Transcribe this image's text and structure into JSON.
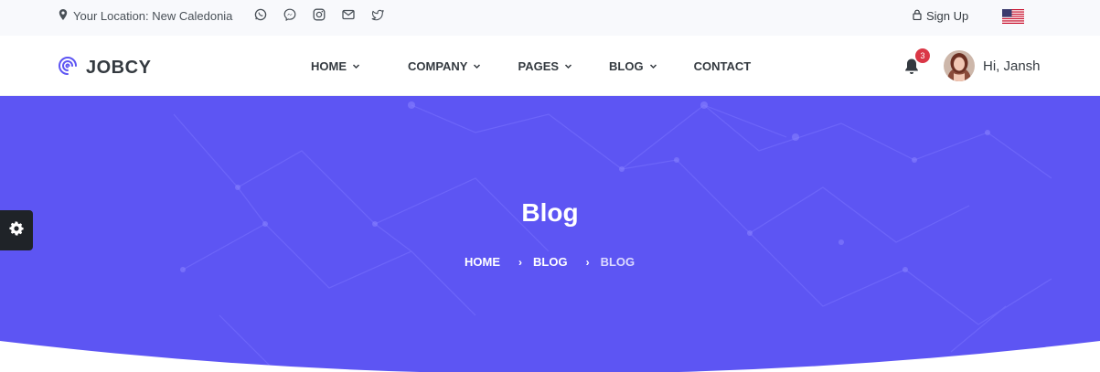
{
  "topbar": {
    "location_label": "Your Location: New Caledonia",
    "social_icons": [
      "whatsapp-icon",
      "messenger-icon",
      "instagram-icon",
      "mail-icon",
      "twitter-icon"
    ],
    "signup_label": "Sign Up",
    "flag_icon": "us-flag-icon"
  },
  "brand": {
    "name": "JOBCY",
    "color": "#5d55f3"
  },
  "nav": {
    "items": [
      {
        "label": "HOME",
        "has_dropdown": true
      },
      {
        "label": "COMPANY",
        "has_dropdown": true
      },
      {
        "label": "PAGES",
        "has_dropdown": true
      },
      {
        "label": "BLOG",
        "has_dropdown": true
      },
      {
        "label": "CONTACT",
        "has_dropdown": false
      }
    ],
    "notification_count": "3",
    "user_greeting": "Hi, Jansh"
  },
  "hero": {
    "title": "Blog",
    "breadcrumb": [
      "HOME",
      "BLOG",
      "BLOG"
    ],
    "background_color": "#5d55f3"
  },
  "colors": {
    "primary": "#5d55f3",
    "badge": "#da3746",
    "dark": "#343a40"
  }
}
